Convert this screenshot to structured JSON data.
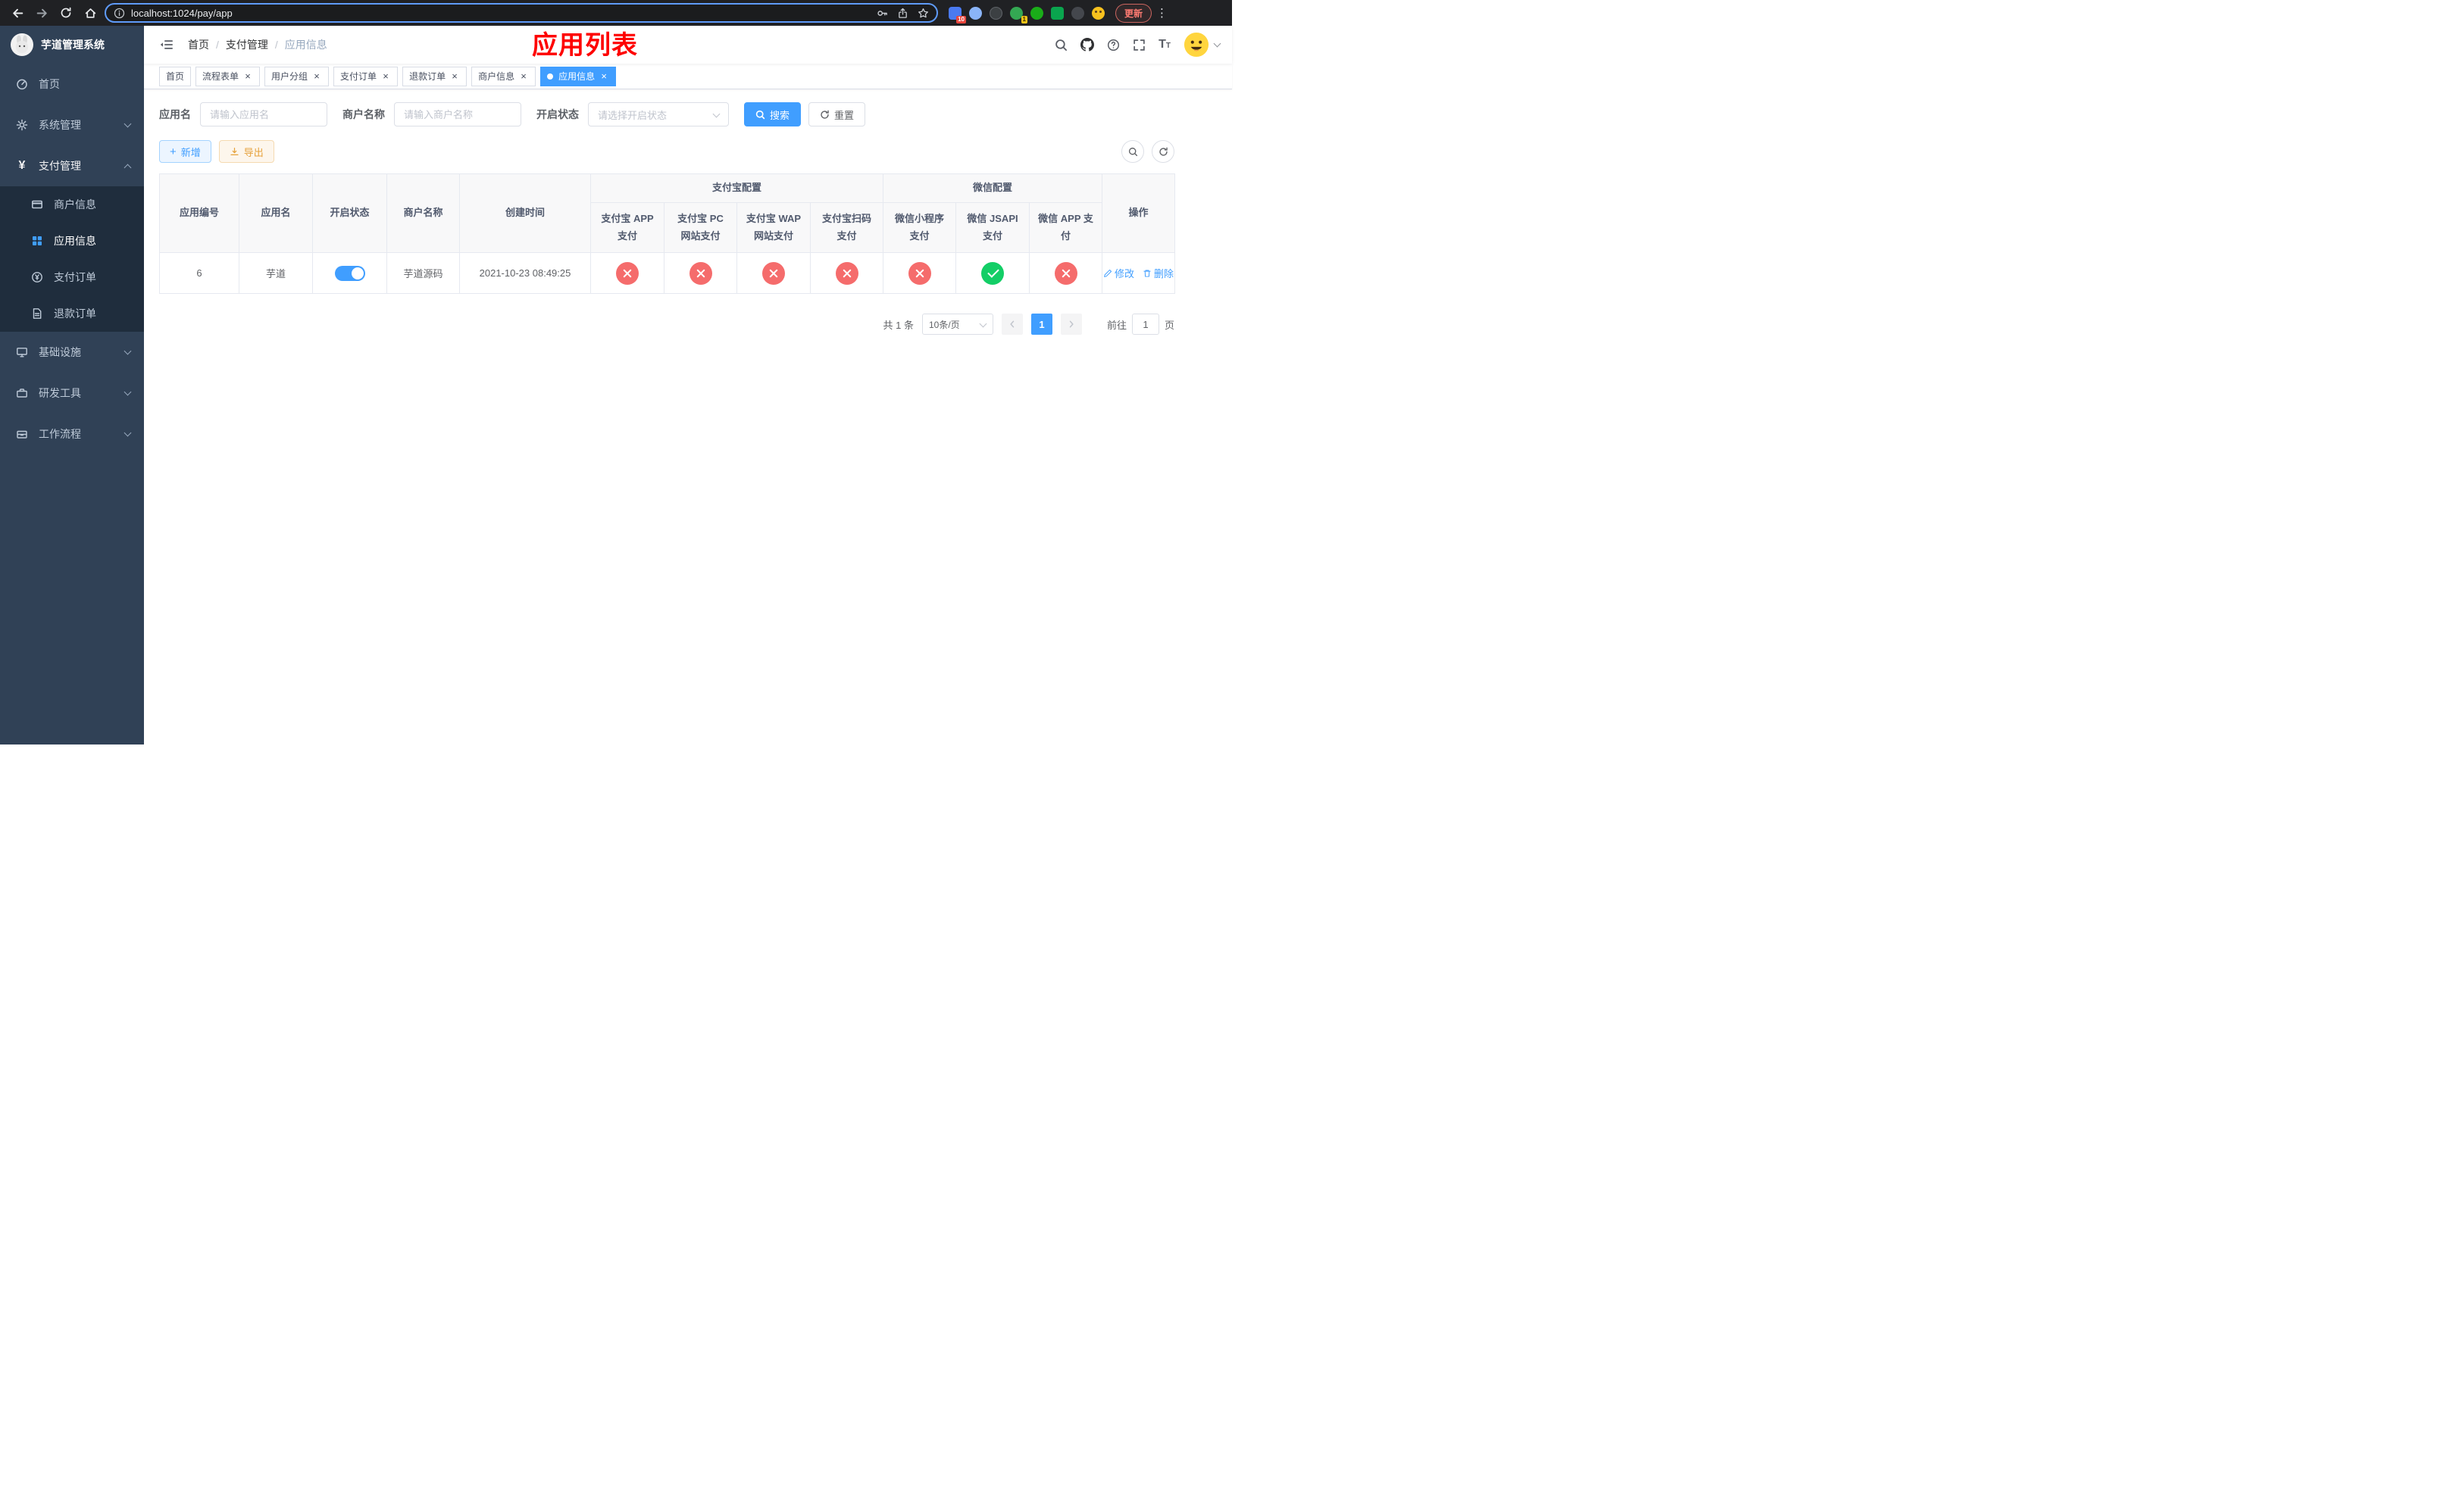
{
  "colors": {
    "primary": "#409eff",
    "success": "#13ce66",
    "danger": "#f56c6c",
    "warning": "#e6a23c",
    "annotation": "#fe0000",
    "sidebar_bg": "#304156",
    "submenu_bg": "#1f2d3d"
  },
  "browser": {
    "url": "localhost:1024/pay/app",
    "update_label": "更新",
    "ext_badge_1": "10",
    "ext_badge_4": "1"
  },
  "sidebar": {
    "title": "芋道管理系统",
    "home": "首页",
    "system": "系统管理",
    "payment": "支付管理",
    "merchant_info": "商户信息",
    "app_info": "应用信息",
    "pay_order": "支付订单",
    "refund_order": "退款订单",
    "infrastructure": "基础设施",
    "dev_tools": "研发工具",
    "workflow": "工作流程"
  },
  "header": {
    "breadcrumb_home": "首页",
    "breadcrumb_section": "支付管理",
    "breadcrumb_current": "应用信息",
    "annotation": "应用列表"
  },
  "tabs": [
    {
      "label": "首页"
    },
    {
      "label": "流程表单"
    },
    {
      "label": "用户分组"
    },
    {
      "label": "支付订单"
    },
    {
      "label": "退款订单"
    },
    {
      "label": "商户信息"
    },
    {
      "label": "应用信息"
    }
  ],
  "filters": {
    "app_name_label": "应用名",
    "app_name_placeholder": "请输入应用名",
    "merchant_label": "商户名称",
    "merchant_placeholder": "请输入商户名称",
    "status_label": "开启状态",
    "status_placeholder": "请选择开启状态",
    "search_label": "搜索",
    "reset_label": "重置"
  },
  "toolbar": {
    "add_label": "新增",
    "export_label": "导出"
  },
  "table": {
    "col_app_id": "应用编号",
    "col_app_name": "应用名",
    "col_status": "开启状态",
    "col_merchant": "商户名称",
    "col_created": "创建时间",
    "group_alipay": "支付宝配置",
    "group_wechat": "微信配置",
    "col_alipay_app": "支付宝 APP 支付",
    "col_alipay_pc": "支付宝 PC 网站支付",
    "col_alipay_wap": "支付宝 WAP 网站支付",
    "col_alipay_qr": "支付宝扫码支付",
    "col_wx_mini": "微信小程序支付",
    "col_wx_jsapi": "微信 JSAPI 支付",
    "col_wx_app": "微信 APP 支付",
    "col_actions": "操作",
    "row": {
      "id": "6",
      "name": "芋道",
      "enabled": true,
      "merchant": "芋道源码",
      "created": "2021-10-23 08:49:25",
      "alipay_app": false,
      "alipay_pc": false,
      "alipay_wap": false,
      "alipay_qr": false,
      "wx_mini": false,
      "wx_jsapi": true,
      "wx_app": false,
      "edit_label": "修改",
      "delete_label": "删除"
    }
  },
  "pagination": {
    "total": "共 1 条",
    "page_size": "10条/页",
    "current_page": "1",
    "goto_label": "前往",
    "goto_value": "1",
    "page_unit": "页"
  }
}
